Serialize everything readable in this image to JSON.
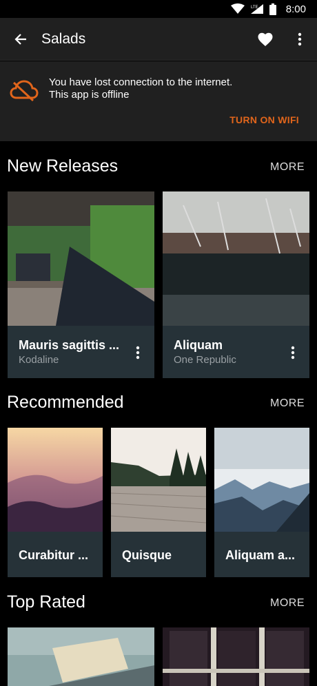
{
  "status_bar": {
    "time": "8:00",
    "network": "LTE"
  },
  "app_bar": {
    "title": "Salads"
  },
  "offline": {
    "line1": "You have lost connection to the internet.",
    "line2": "This app is offline",
    "action": "TURN ON WIFI"
  },
  "sections": {
    "new_releases": {
      "title": "New Releases",
      "more": "MORE",
      "cards": [
        {
          "title": "Mauris sagittis ...",
          "subtitle": "Kodaline"
        },
        {
          "title": "Aliquam",
          "subtitle": "One Republic"
        }
      ]
    },
    "recommended": {
      "title": "Recommended",
      "more": "MORE",
      "cards": [
        {
          "title": "Curabitur ..."
        },
        {
          "title": "Quisque"
        },
        {
          "title": "Aliquam a..."
        }
      ]
    },
    "top_rated": {
      "title": "Top Rated",
      "more": "MORE"
    }
  },
  "colors": {
    "accent": "#e1651b",
    "card_bg": "#263238",
    "bar_bg": "#202020"
  }
}
